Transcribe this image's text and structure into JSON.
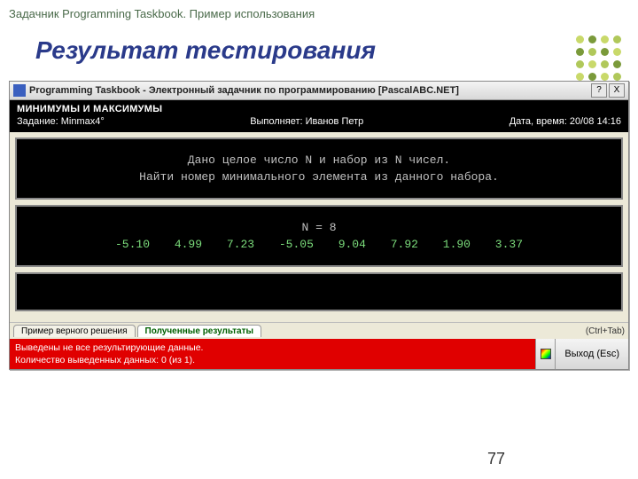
{
  "slide": {
    "header": "Задачник Programming Taskbook. Пример использования",
    "title": "Результат тестирования",
    "page_number": "77"
  },
  "window": {
    "title": "Programming Taskbook - Электронный задачник по программированию [PascalABC.NET]",
    "help_btn": "?",
    "close_btn": "X"
  },
  "info": {
    "category": "МИНИМУМЫ И МАКСИМУМЫ",
    "task_label": "Задание: Minmax4°",
    "student_label": "Выполняет: Иванов Петр",
    "datetime_label": "Дата, время: 20/08 14:16"
  },
  "problem": {
    "line1": "Дано целое число N и набор из N чисел.",
    "line2": "Найти номер минимального элемента из данного набора."
  },
  "data": {
    "n_line": "N = 8",
    "values": [
      "-5.10",
      "4.99",
      "7.23",
      "-5.05",
      "9.04",
      "7.92",
      "1.90",
      "3.37"
    ]
  },
  "tabs": {
    "tab1": "Пример верного решения",
    "tab2": "Полученные результаты",
    "shortcut": "(Ctrl+Tab)"
  },
  "error": {
    "line1": "Выведены не все результирующие данные.",
    "line2": "Количество выведенных данных: 0 (из 1)."
  },
  "exit_button": "Выход (Esc)"
}
